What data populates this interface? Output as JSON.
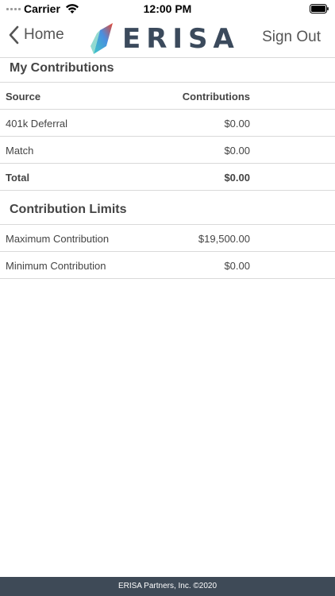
{
  "status_bar": {
    "carrier": "Carrier",
    "time": "12:00 PM"
  },
  "nav": {
    "back_label": "Home",
    "logo_text": "ERISA",
    "sign_out_label": "Sign Out"
  },
  "my_contributions": {
    "title": "My Contributions",
    "headers": {
      "source": "Source",
      "contributions": "Contributions"
    },
    "rows": [
      {
        "source": "401k Deferral",
        "amount": "$0.00"
      },
      {
        "source": "Match",
        "amount": "$0.00"
      }
    ],
    "total": {
      "label": "Total",
      "amount": "$0.00"
    }
  },
  "contribution_limits": {
    "title": "Contribution Limits",
    "rows": [
      {
        "label": "Maximum Contribution",
        "amount": "$19,500.00"
      },
      {
        "label": "Minimum Contribution",
        "amount": "$0.00"
      }
    ]
  },
  "footer": {
    "text": "ERISA Partners, Inc. ©2020"
  },
  "colors": {
    "footer_bg": "#3e4a57",
    "logo_text": "#3b4a5c",
    "divider": "#d9d9d9"
  }
}
